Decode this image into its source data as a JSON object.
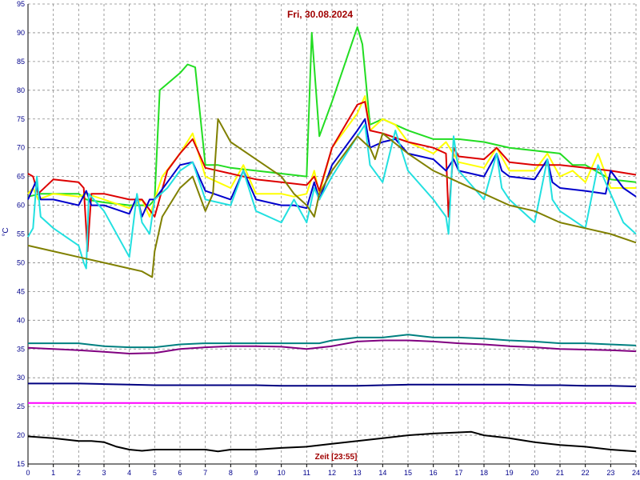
{
  "chart_data": {
    "type": "line",
    "title": "Fri, 30.08.2024",
    "xlabel": "Zeit [23:55]",
    "ylabel": "°C",
    "xlim": [
      0,
      24
    ],
    "ylim": [
      15,
      95
    ],
    "x_ticks": [
      0,
      1,
      2,
      3,
      4,
      5,
      6,
      7,
      8,
      9,
      10,
      11,
      12,
      13,
      14,
      15,
      16,
      17,
      18,
      19,
      20,
      21,
      22,
      23,
      24
    ],
    "y_ticks": [
      15,
      20,
      25,
      30,
      35,
      40,
      45,
      50,
      55,
      60,
      65,
      70,
      75,
      80,
      85,
      90,
      95
    ],
    "grid": true,
    "series": [
      {
        "color": "#22dd22",
        "x": [
          0,
          0.5,
          1,
          2,
          2.3,
          3,
          4,
          4.5,
          4.8,
          5,
          5.2,
          6,
          6.3,
          6.6,
          7,
          7.5,
          8,
          9,
          10,
          11,
          11.2,
          11.5,
          12,
          13,
          13.2,
          13.5,
          14,
          15,
          16,
          17,
          18,
          19,
          20,
          21,
          21.5,
          22,
          23,
          24
        ],
        "y": [
          61.5,
          62,
          62,
          62,
          61,
          60.5,
          60,
          60,
          60,
          61,
          80,
          83,
          84.5,
          84,
          67,
          67,
          66.5,
          66,
          65.5,
          65,
          90,
          72,
          78,
          91,
          88,
          74,
          75,
          73,
          71.5,
          71.5,
          71,
          70,
          69.5,
          69,
          67,
          67,
          64.5,
          64
        ]
      },
      {
        "color": "#ffff00",
        "x": [
          0,
          0.2,
          0.4,
          1,
          2,
          2.3,
          3,
          4,
          4.5,
          4.8,
          5,
          5.3,
          6,
          6.5,
          7,
          7.5,
          8,
          8.5,
          9,
          10,
          10.5,
          11,
          11.3,
          11.5,
          12,
          13,
          13.3,
          13.5,
          14,
          14.5,
          15,
          16,
          16.5,
          17,
          18,
          18.5,
          19,
          20,
          20.5,
          21,
          21.5,
          22,
          22.5,
          23,
          24
        ],
        "y": [
          62,
          63,
          61,
          62,
          61.5,
          62,
          61,
          59.5,
          61,
          58,
          61,
          65,
          69,
          72.5,
          65,
          64,
          63,
          67,
          62,
          62,
          61.5,
          62,
          66,
          62,
          70,
          76,
          79,
          73,
          75,
          74,
          71,
          69,
          71,
          67.5,
          66.5,
          70,
          66,
          66,
          69,
          65,
          66,
          64,
          69,
          63,
          63
        ]
      },
      {
        "color": "#dd0000",
        "x": [
          0,
          0.2,
          0.4,
          1,
          2,
          2.2,
          2.35,
          2.5,
          3,
          4,
          4.5,
          5,
          5.5,
          6,
          6.5,
          7,
          8,
          9,
          10,
          11,
          11.3,
          11.5,
          12,
          13,
          13.3,
          13.5,
          14,
          15,
          16,
          16.5,
          16.6,
          16.8,
          17,
          18,
          18.5,
          19,
          20,
          21,
          22,
          23,
          24
        ],
        "y": [
          65.5,
          65,
          62,
          64.5,
          64,
          63,
          52,
          62,
          62,
          61,
          61,
          58,
          66,
          69,
          71.5,
          66.5,
          65.5,
          64.5,
          64,
          63.5,
          65,
          62.5,
          70,
          77.5,
          78,
          73,
          72.5,
          71,
          70,
          69,
          58,
          70,
          68.5,
          68,
          70,
          67.5,
          67,
          67,
          66.5,
          66,
          65.3
        ]
      },
      {
        "color": "#0000cc",
        "x": [
          0,
          0.3,
          0.5,
          1,
          2,
          2.3,
          2.5,
          3,
          4,
          4.3,
          4.5,
          4.8,
          5,
          5.5,
          6,
          6.5,
          7,
          8,
          8.5,
          9,
          10,
          10.5,
          11,
          11.3,
          11.5,
          12,
          13,
          13.3,
          13.5,
          14,
          14.5,
          15,
          16,
          16.5,
          16.8,
          17,
          18,
          18.5,
          18.7,
          19,
          20,
          20.5,
          20.7,
          21,
          22,
          22.8,
          23,
          23.5,
          24
        ],
        "y": [
          61,
          64,
          61,
          61,
          60,
          62.5,
          60,
          60,
          58.5,
          61.5,
          58,
          61,
          61,
          64,
          67,
          67.5,
          62.5,
          61,
          66,
          61,
          60,
          60,
          59.5,
          64,
          61,
          67,
          73,
          75,
          70,
          71,
          71.5,
          69,
          68,
          66,
          68,
          66,
          65,
          69,
          66,
          65,
          64.5,
          68,
          64,
          63,
          62.5,
          62,
          66,
          63,
          61.5
        ]
      },
      {
        "color": "#22e0e0",
        "x": [
          0,
          0.2,
          0.35,
          0.5,
          1,
          2,
          2.2,
          2.3,
          2.4,
          3,
          4,
          4.3,
          4.5,
          4.8,
          5,
          5.5,
          6,
          6.5,
          7,
          8,
          8.5,
          9,
          10,
          10.5,
          11,
          11.3,
          11.5,
          12,
          13,
          13.3,
          13.5,
          14,
          14.5,
          15,
          16,
          16.5,
          16.6,
          16.8,
          17,
          18,
          18.5,
          18.7,
          19,
          20,
          20.5,
          20.7,
          21,
          22,
          22.5,
          22.7,
          23,
          23.5,
          24
        ],
        "y": [
          54.5,
          56,
          65,
          58,
          56,
          53,
          50,
          49,
          62,
          59,
          51,
          62,
          57,
          55,
          61,
          63,
          66,
          67.5,
          61,
          60,
          66,
          59,
          57,
          61,
          57,
          63,
          61,
          65,
          72,
          74,
          67,
          64,
          73,
          66,
          61,
          58,
          55,
          72,
          66,
          61,
          69,
          63,
          61,
          57,
          68,
          61,
          59,
          56,
          67,
          65,
          62,
          57,
          55
        ]
      },
      {
        "color": "#808000",
        "x": [
          0,
          0.5,
          1,
          2,
          3,
          4,
          4.5,
          4.9,
          5,
          5.3,
          6,
          6.5,
          7,
          7.3,
          7.5,
          8,
          9,
          10,
          10.5,
          11,
          11.3,
          11.5,
          12,
          13,
          13.5,
          13.7,
          14,
          15,
          16,
          17,
          18,
          19,
          20,
          21,
          22,
          23,
          24
        ],
        "y": [
          53,
          52.5,
          52,
          51,
          50,
          49,
          48.5,
          47.5,
          52,
          58,
          63,
          65,
          59,
          62,
          75,
          71,
          68,
          65,
          62,
          60,
          58,
          62,
          66,
          72,
          70,
          68,
          72.5,
          69,
          66,
          64,
          62,
          60,
          59,
          57,
          56,
          55,
          53.5
        ]
      },
      {
        "color": "#008080",
        "x": [
          0,
          1,
          2,
          3,
          4,
          5,
          6,
          7,
          8,
          9,
          10,
          11,
          11.5,
          12,
          13,
          14,
          15,
          16,
          17,
          18,
          19,
          20,
          21,
          22,
          23,
          24
        ],
        "y": [
          36,
          36,
          36,
          35.5,
          35.3,
          35.3,
          35.8,
          36,
          36,
          36,
          36,
          36,
          36,
          36.5,
          37,
          37,
          37.5,
          37,
          37,
          36.8,
          36.5,
          36.3,
          36,
          36,
          35.8,
          35.6
        ]
      },
      {
        "color": "#800080",
        "x": [
          0,
          1,
          2,
          3,
          4,
          5,
          6,
          7,
          8,
          9,
          10,
          11,
          12,
          13,
          14,
          15,
          16,
          17,
          18,
          19,
          20,
          21,
          22,
          23,
          24
        ],
        "y": [
          35.2,
          35,
          34.8,
          34.5,
          34.2,
          34.3,
          35,
          35.3,
          35.5,
          35.5,
          35.4,
          35,
          35.5,
          36.3,
          36.5,
          36.5,
          36.3,
          36,
          35.8,
          35.5,
          35.3,
          35,
          34.9,
          34.8,
          34.6
        ]
      },
      {
        "color": "#000080",
        "x": [
          0,
          1,
          2,
          3,
          4,
          5,
          6,
          7,
          8,
          9,
          10,
          11,
          12,
          13,
          14,
          15,
          16,
          17,
          18,
          19,
          20,
          21,
          22,
          23,
          24
        ],
        "y": [
          29,
          29,
          29,
          28.9,
          28.8,
          28.7,
          28.7,
          28.7,
          28.7,
          28.7,
          28.6,
          28.6,
          28.6,
          28.6,
          28.7,
          28.8,
          28.8,
          28.8,
          28.8,
          28.8,
          28.7,
          28.7,
          28.6,
          28.6,
          28.5
        ]
      },
      {
        "color": "#ff00ff",
        "x": [
          0,
          24
        ],
        "y": [
          25.6,
          25.6
        ]
      },
      {
        "color": "#000000",
        "x": [
          0,
          1,
          2,
          2.5,
          3,
          3.5,
          4,
          4.5,
          5,
          6,
          7,
          7.5,
          8,
          9,
          10,
          11,
          12,
          13,
          14,
          15,
          16,
          17,
          17.5,
          18,
          19,
          20,
          21,
          22,
          23,
          24
        ],
        "y": [
          19.8,
          19.5,
          19,
          19,
          18.8,
          18,
          17.5,
          17.3,
          17.5,
          17.5,
          17.5,
          17.2,
          17.5,
          17.5,
          17.8,
          18,
          18.5,
          19,
          19.5,
          20,
          20.3,
          20.5,
          20.6,
          20,
          19.5,
          18.8,
          18.3,
          18,
          17.5,
          17.2
        ]
      }
    ]
  }
}
